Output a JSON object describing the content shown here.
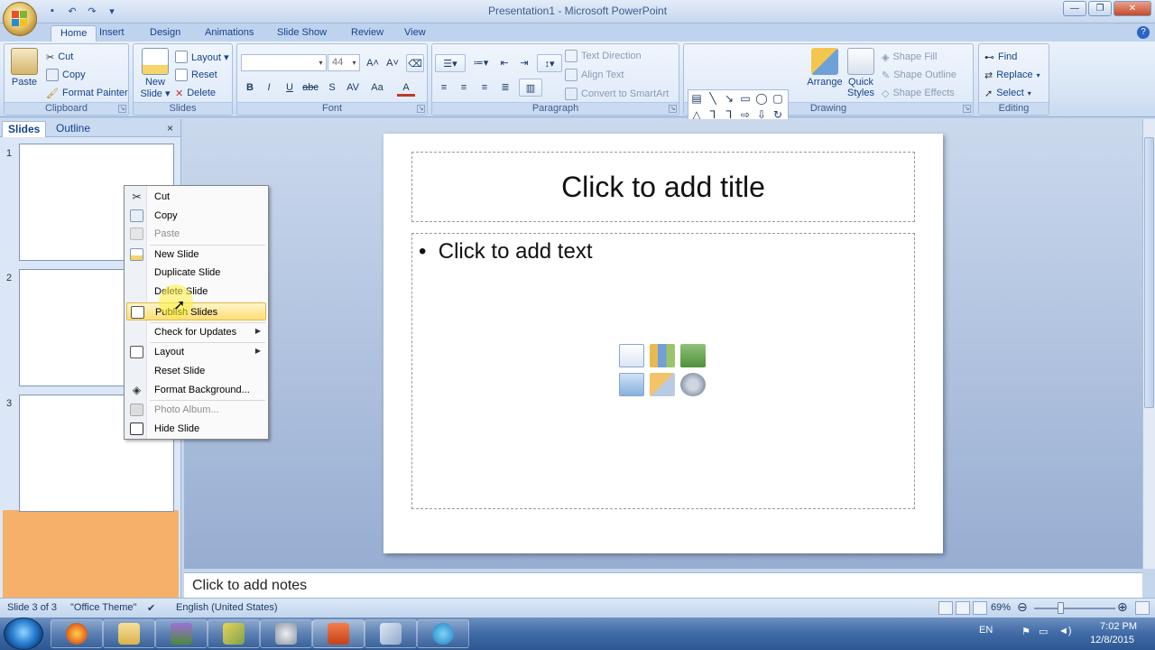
{
  "window": {
    "title": "Presentation1 - Microsoft PowerPoint",
    "controls": {
      "minimize": "—",
      "maximize": "❐",
      "close": "✕"
    }
  },
  "quick_access": [
    "save-icon",
    "undo-icon",
    "redo-icon",
    "customize-icon"
  ],
  "tabs": [
    "Home",
    "Insert",
    "Design",
    "Animations",
    "Slide Show",
    "Review",
    "View"
  ],
  "active_tab": "Home",
  "ribbon": {
    "clipboard": {
      "label": "Clipboard",
      "paste": "Paste",
      "cut": "Cut",
      "copy": "Copy",
      "format_painter": "Format Painter"
    },
    "slides": {
      "label": "Slides",
      "new_slide_1": "New",
      "new_slide_2": "Slide ▾",
      "layout": "Layout ▾",
      "reset": "Reset",
      "delete": "Delete"
    },
    "font": {
      "label": "Font",
      "font_name": "",
      "font_size": "44",
      "bold": "B",
      "italic": "I",
      "underline": "U",
      "strike": "abc",
      "shadow": "S",
      "spacing": "AV",
      "case": "Aa",
      "color": "A"
    },
    "paragraph": {
      "label": "Paragraph",
      "text_direction": "Text Direction",
      "align_text": "Align Text",
      "convert_smartart": "Convert to SmartArt"
    },
    "drawing": {
      "label": "Drawing",
      "arrange": "Arrange",
      "quick_styles_1": "Quick",
      "quick_styles_2": "Styles",
      "shape_fill": "Shape Fill",
      "shape_outline": "Shape Outline",
      "shape_effects": "Shape Effects"
    },
    "editing": {
      "label": "Editing",
      "find": "Find",
      "replace": "Replace",
      "select": "Select"
    }
  },
  "pane": {
    "tabs": [
      "Slides",
      "Outline"
    ],
    "close": "×",
    "slide_numbers": [
      "1",
      "2",
      "3"
    ]
  },
  "slide": {
    "title_placeholder": "Click to add title",
    "body_placeholder": "Click to add text",
    "bullet": "•"
  },
  "notes": {
    "placeholder": "Click to add notes"
  },
  "context_menu": {
    "items": [
      {
        "label": "Cut",
        "icon": "scissors-icon",
        "enabled": true
      },
      {
        "label": "Copy",
        "icon": "copy-icon",
        "enabled": true
      },
      {
        "label": "Paste",
        "icon": "paste-icon",
        "enabled": false
      },
      {
        "label": "New Slide",
        "icon": "new-slide-icon",
        "enabled": true
      },
      {
        "label": "Duplicate Slide",
        "icon": "",
        "enabled": true
      },
      {
        "label": "Delete Slide",
        "icon": "",
        "enabled": true
      },
      {
        "label": "Publish Slides",
        "icon": "publish-icon",
        "enabled": true,
        "highlighted": true
      },
      {
        "label": "Check for Updates",
        "icon": "",
        "enabled": true,
        "submenu": true
      },
      {
        "label": "Layout",
        "icon": "layout-icon",
        "enabled": true,
        "submenu": true
      },
      {
        "label": "Reset Slide",
        "icon": "",
        "enabled": true
      },
      {
        "label": "Format Background...",
        "icon": "paint-bucket-icon",
        "enabled": true
      },
      {
        "label": "Photo Album...",
        "icon": "photo-album-icon",
        "enabled": false
      },
      {
        "label": "Hide Slide",
        "icon": "hide-slide-icon",
        "enabled": true
      }
    ]
  },
  "status": {
    "slide_info": "Slide 3 of 3",
    "theme": "\"Office Theme\"",
    "language": "English (United States)",
    "zoom": "69%",
    "zoom_out": "⊖",
    "zoom_in": "⊕"
  },
  "taskbar": {
    "lang": "EN",
    "time": "7:02 PM",
    "date": "12/8/2015"
  },
  "colors": {
    "ribbon_bg": "#d7e4f5",
    "accent": "#15428b",
    "highlight": "#ffde77",
    "selected_thumb": "#f2a15e"
  }
}
